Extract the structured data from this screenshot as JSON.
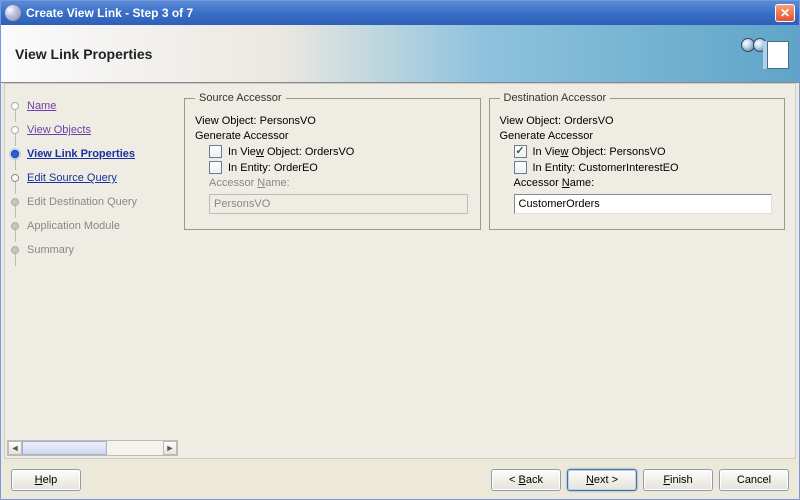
{
  "window": {
    "title": "Create View Link - Step 3 of 7"
  },
  "header": {
    "page_title": "View Link Properties"
  },
  "nav": {
    "steps": [
      {
        "label": "Name"
      },
      {
        "label": "View Objects"
      },
      {
        "label": "View Link Properties"
      },
      {
        "label": "Edit Source Query"
      },
      {
        "label": "Edit Destination Query"
      },
      {
        "label": "Application Module"
      },
      {
        "label": "Summary"
      }
    ]
  },
  "source": {
    "legend": "Source Accessor",
    "view_object_label": "View Object: PersonsVO",
    "generate_label": "Generate Accessor",
    "in_view_object_prefix": "In Vie",
    "in_view_object_key": "w",
    "in_view_object_suffix": " Object: OrdersVO",
    "in_entity_label": "In Entity: OrderEO",
    "accessor_name_prefix": "Accessor ",
    "accessor_name_key": "N",
    "accessor_name_suffix": "ame:",
    "accessor_value": "PersonsVO"
  },
  "destination": {
    "legend": "Destination Accessor",
    "view_object_label": "View Object: OrdersVO",
    "generate_label": "Generate Accessor",
    "in_view_object_prefix": "In Vie",
    "in_view_object_key": "w",
    "in_view_object_suffix": " Object: PersonsVO",
    "in_entity_label": "In Entity: CustomerInterestEO",
    "accessor_name_prefix": "Accessor ",
    "accessor_name_key": "N",
    "accessor_name_suffix": "ame:",
    "accessor_value": "CustomerOrders"
  },
  "buttons": {
    "help_key": "H",
    "help_rest": "elp",
    "back_prefix": "< ",
    "back_key": "B",
    "back_rest": "ack",
    "next_key": "N",
    "next_rest": "ext >",
    "finish_key": "F",
    "finish_rest": "inish",
    "cancel": "Cancel"
  },
  "checkmark": "✓"
}
